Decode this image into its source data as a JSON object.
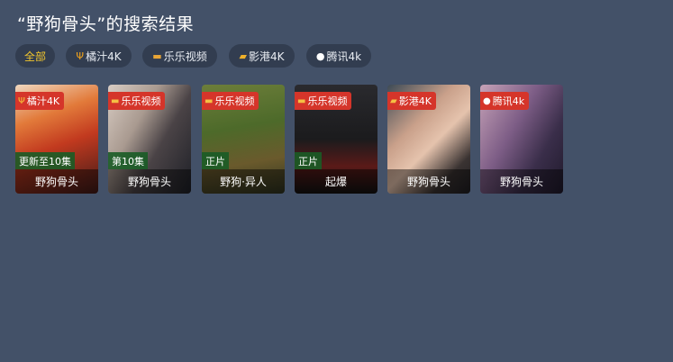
{
  "header": {
    "title": "“野狗骨头”的搜索结果"
  },
  "filters": [
    {
      "label": "全部",
      "icon": "",
      "active": true
    },
    {
      "label": "橘汁4K",
      "icon": "orange-fork-icon",
      "active": false
    },
    {
      "label": "乐乐视频",
      "icon": "ticket-icon",
      "active": false
    },
    {
      "label": "影港4K",
      "icon": "film-icon",
      "active": false
    },
    {
      "label": "腾讯4k",
      "icon": "penguin-icon",
      "active": false
    }
  ],
  "results": [
    {
      "source": "橘汁4K",
      "source_icon": "orange-fork-icon",
      "badge": "更新至10集",
      "title": "野狗骨头"
    },
    {
      "source": "乐乐视频",
      "source_icon": "ticket-icon",
      "badge": "第10集",
      "title": "野狗骨头"
    },
    {
      "source": "乐乐视频",
      "source_icon": "ticket-icon",
      "badge": "正片",
      "title": "野狗·异人"
    },
    {
      "source": "乐乐视频",
      "source_icon": "ticket-icon",
      "badge": "正片",
      "title": "起爆"
    },
    {
      "source": "影港4K",
      "source_icon": "film-icon",
      "badge": "",
      "title": "野狗骨头"
    },
    {
      "source": "腾讯4k",
      "source_icon": "penguin-icon",
      "badge": "",
      "title": "野狗骨头"
    }
  ],
  "colors": {
    "background": "#435168",
    "chip": "#323d50",
    "active_chip_text": "#f2c62c",
    "source_badge": "#d5352a",
    "episode_badge": "#1a5c26"
  }
}
